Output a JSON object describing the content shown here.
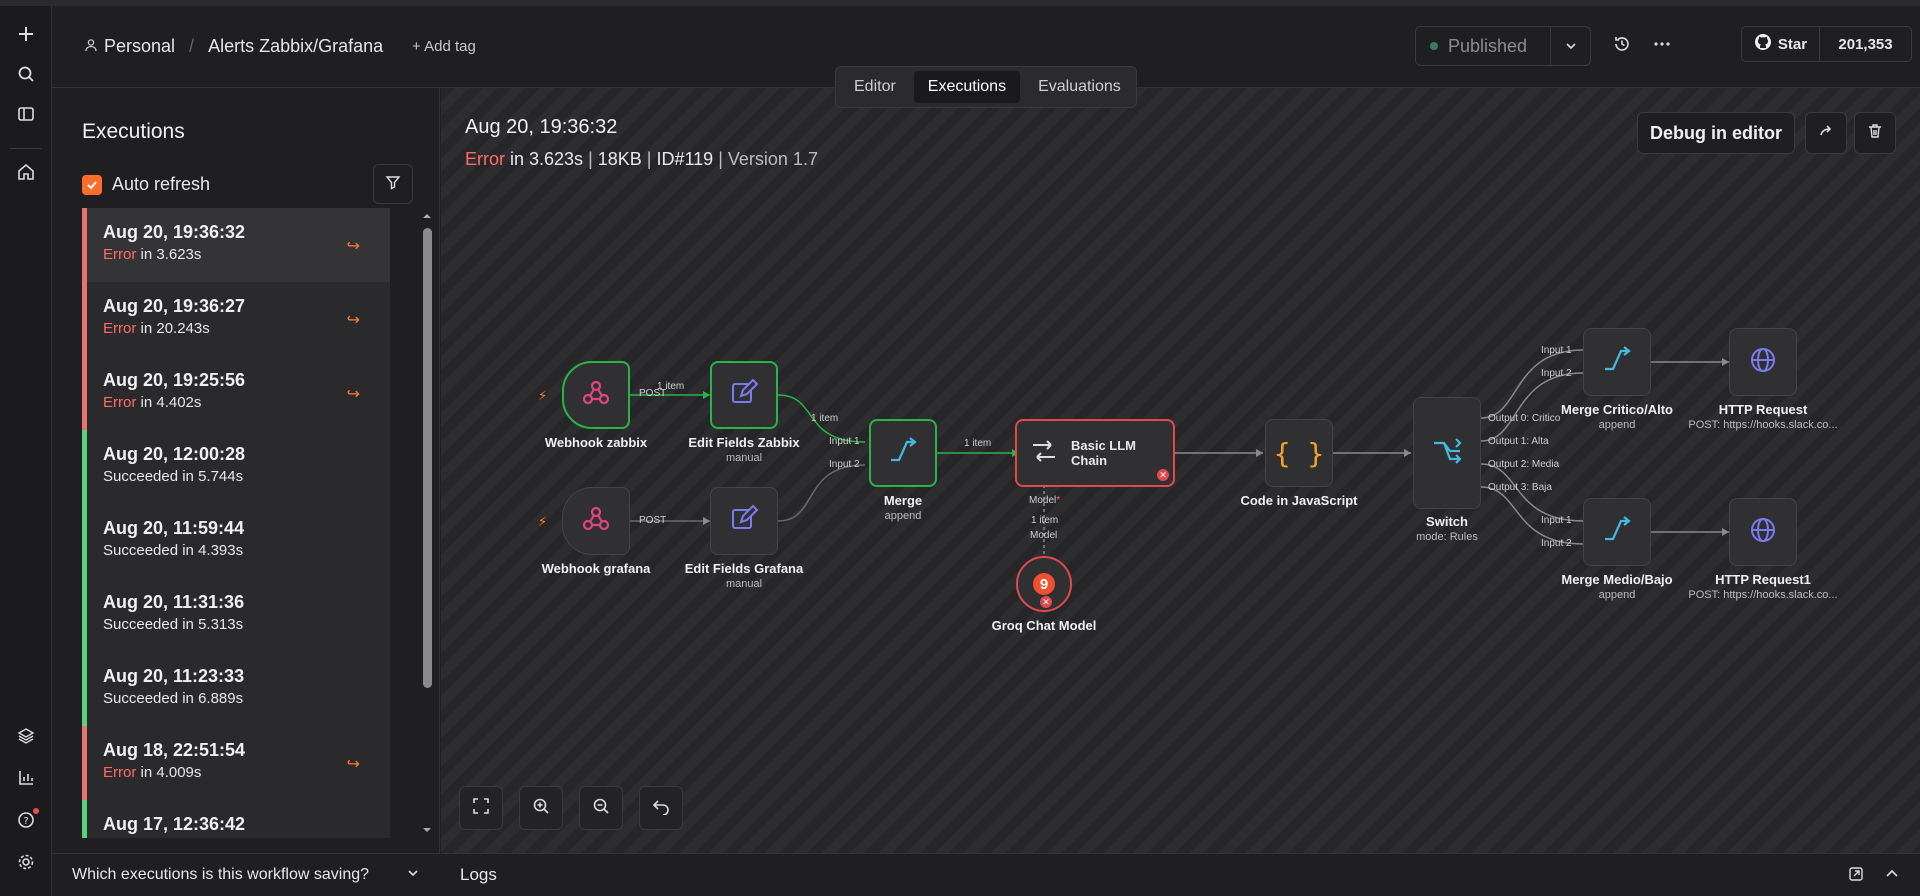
{
  "rail": {
    "icons": [
      "plus-icon",
      "search-icon",
      "sidebar-toggle-icon",
      "home-icon",
      "templates-icon",
      "insights-icon",
      "help-icon",
      "settings-icon"
    ]
  },
  "header": {
    "project": "Personal",
    "workflow_name": "Alerts Zabbix/Grafana",
    "add_tag": "+ Add tag",
    "publish_status": "Published",
    "github_star_label": "Star",
    "github_stars": "201,353"
  },
  "tabs": [
    {
      "label": "Editor",
      "active": false
    },
    {
      "label": "Executions",
      "active": true
    },
    {
      "label": "Evaluations",
      "active": false
    }
  ],
  "executions_panel": {
    "title": "Executions",
    "auto_refresh_label": "Auto refresh",
    "auto_refresh_checked": true,
    "items": [
      {
        "time": "Aug 20, 19:36:32",
        "status": "Error",
        "duration": " in 3.623s",
        "failed": true,
        "selected": true
      },
      {
        "time": "Aug 20, 19:36:27",
        "status": "Error",
        "duration": " in 20.243s",
        "failed": true
      },
      {
        "time": "Aug 20, 19:25:56",
        "status": "Error",
        "duration": " in 4.402s",
        "failed": true
      },
      {
        "time": "Aug 20, 12:00:28",
        "status": "Succeeded in 5.744s",
        "duration": "",
        "failed": false
      },
      {
        "time": "Aug 20, 11:59:44",
        "status": "Succeeded in 4.393s",
        "duration": "",
        "failed": false
      },
      {
        "time": "Aug 20, 11:31:36",
        "status": "Succeeded in 5.313s",
        "duration": "",
        "failed": false
      },
      {
        "time": "Aug 20, 11:23:33",
        "status": "Succeeded in 6.889s",
        "duration": "",
        "failed": false
      },
      {
        "time": "Aug 18, 22:51:54",
        "status": "Error",
        "duration": " in 4.009s",
        "failed": true
      },
      {
        "time": "Aug 17, 12:36:42",
        "status": "",
        "duration": "",
        "failed": false
      }
    ],
    "saving_question": "Which executions is this workflow saving?"
  },
  "execution_detail": {
    "timestamp": "Aug 20, 19:36:32",
    "status": "Error",
    "duration": " in 3.623s",
    "size": "18KB",
    "id": "ID#119",
    "version": "Version 1.7",
    "debug_button": "Debug in editor"
  },
  "workflow": {
    "nodes": {
      "webhook_zabbix": {
        "name": "Webhook zabbix"
      },
      "webhook_grafana": {
        "name": "Webhook grafana"
      },
      "edit_zabbix": {
        "name": "Edit Fields Zabbix",
        "sub": "manual"
      },
      "edit_grafana": {
        "name": "Edit Fields Grafana",
        "sub": "manual"
      },
      "merge": {
        "name": "Merge",
        "sub": "append"
      },
      "llm_chain": {
        "name": "Basic LLM Chain"
      },
      "groq": {
        "name": "Groq Chat Model"
      },
      "code": {
        "name": "Code in JavaScript"
      },
      "switch": {
        "name": "Switch",
        "sub": "mode: Rules"
      },
      "merge_critico": {
        "name": "Merge Critico/Alto",
        "sub": "append"
      },
      "merge_medio": {
        "name": "Merge Medio/Bajo",
        "sub": "append"
      },
      "http1": {
        "name": "HTTP Request",
        "sub": "POST: https://hooks.slack.co..."
      },
      "http2": {
        "name": "HTTP Request1",
        "sub": "POST: https://hooks.slack.co..."
      }
    },
    "edge_labels": {
      "post": "POST",
      "one_item": "1 item",
      "input1": "Input 1",
      "input2": "Input 2",
      "model_req": "Model",
      "model": "Model",
      "out0": "Output 0: Critico",
      "out1": "Output 1: Alta",
      "out2": "Output 2: Media",
      "out3": "Output 3: Baja"
    }
  },
  "logs": {
    "title": "Logs"
  },
  "colors": {
    "error": "#ff6b6b",
    "success": "#5ccf7a",
    "accent": "#ff6d2d"
  }
}
